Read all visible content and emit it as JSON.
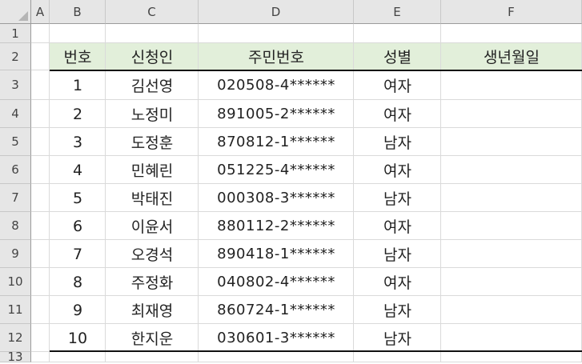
{
  "columns": [
    "A",
    "B",
    "C",
    "D",
    "E",
    "F"
  ],
  "rows": [
    "1",
    "2",
    "3",
    "4",
    "5",
    "6",
    "7",
    "8",
    "9",
    "10",
    "11",
    "12",
    "13"
  ],
  "table": {
    "headers": [
      "번호",
      "신청인",
      "주민번호",
      "성별",
      "생년월일"
    ],
    "records": [
      [
        "1",
        "김선영",
        "020508-4******",
        "여자",
        ""
      ],
      [
        "2",
        "노정미",
        "891005-2******",
        "여자",
        ""
      ],
      [
        "3",
        "도정훈",
        "870812-1******",
        "남자",
        ""
      ],
      [
        "4",
        "민혜린",
        "051225-4******",
        "여자",
        ""
      ],
      [
        "5",
        "박태진",
        "000308-3******",
        "남자",
        ""
      ],
      [
        "6",
        "이윤서",
        "880112-2******",
        "여자",
        ""
      ],
      [
        "7",
        "오경석",
        "890418-1******",
        "남자",
        ""
      ],
      [
        "8",
        "주정화",
        "040802-4******",
        "여자",
        ""
      ],
      [
        "9",
        "최재영",
        "860724-1******",
        "남자",
        ""
      ],
      [
        "10",
        "한지운",
        "030601-3******",
        "남자",
        ""
      ]
    ]
  },
  "colors": {
    "header_fill": "#e2efda",
    "gridline": "#dadada",
    "sheet_header_bg": "#e6e6e6"
  }
}
